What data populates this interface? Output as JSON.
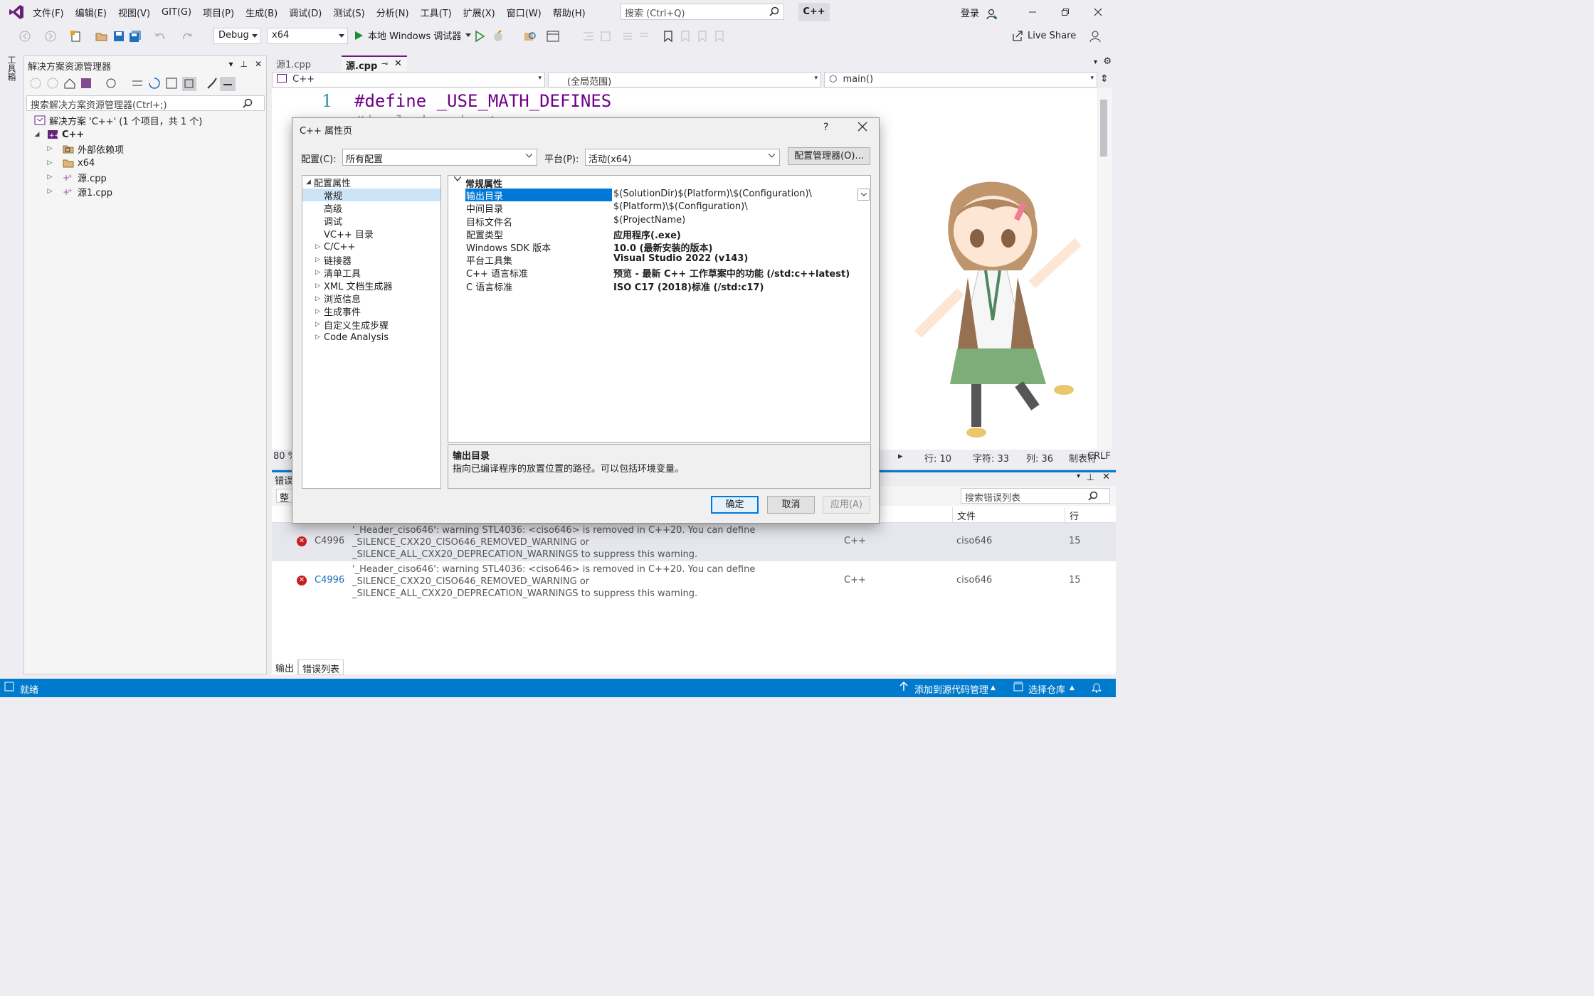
{
  "menubar": {
    "items": [
      "文件(F)",
      "编辑(E)",
      "视图(V)",
      "GIT(G)",
      "项目(P)",
      "生成(B)",
      "调试(D)",
      "测试(S)",
      "分析(N)",
      "工具(T)",
      "扩展(X)",
      "窗口(W)",
      "帮助(H)"
    ],
    "search_placeholder": "搜索 (Ctrl+Q)",
    "solution_chip": "C++",
    "login": "登录"
  },
  "toolbar": {
    "config": "Debug",
    "platform": "x64",
    "run_label": "本地 Windows 调试器",
    "live_share": "Live Share"
  },
  "toolbox_strip": "工具箱",
  "solution_explorer": {
    "title": "解决方案资源管理器",
    "search_placeholder": "搜索解决方案资源管理器(Ctrl+;)",
    "tree": [
      {
        "label": "解决方案 'C++' (1 个项目，共 1 个)",
        "level": 0,
        "icon": "solution-icon"
      },
      {
        "label": "C++",
        "level": 1,
        "icon": "project-icon"
      },
      {
        "label": "外部依赖项",
        "level": 2,
        "icon": "folder-icon"
      },
      {
        "label": "x64",
        "level": 2,
        "icon": "folder-icon"
      },
      {
        "label": "源.cpp",
        "level": 2,
        "icon": "cpp-file-icon"
      },
      {
        "label": "源1.cpp",
        "level": 2,
        "icon": "cpp-file-icon"
      }
    ]
  },
  "editor": {
    "tabs": [
      {
        "label": "源1.cpp",
        "active": false
      },
      {
        "label": "源.cpp",
        "active": true
      }
    ],
    "nav": {
      "project": "C++",
      "scope": "(全局范围)",
      "member": "main()"
    },
    "line1_number": "1",
    "line1_code": "#define _USE_MATH_DEFINES",
    "line2_code": "#include <iostream>",
    "zoom": "80 %",
    "status": {
      "line": "行: 10",
      "char": "字符: 33",
      "col": "列: 36",
      "tab": "制表符",
      "eol": "CRLF"
    }
  },
  "error_list": {
    "title": "错误",
    "scope": "整",
    "search_placeholder": "搜索错误列表",
    "columns": {
      "file": "文件",
      "line": "行"
    },
    "rows": [
      {
        "code": "C4996",
        "description": "'_Header_ciso646': warning STL4036: <ciso646> is removed in C++20. You can define _SILENCE_CXX20_CISO646_REMOVED_WARNING or _SILENCE_ALL_CXX20_DEPRECATION_WARNINGS to suppress this warning.",
        "project": "C++",
        "file": "ciso646",
        "line": "15"
      },
      {
        "code": "C4996",
        "description": "'_Header_ciso646': warning STL4036: <ciso646> is removed in C++20. You can define _SILENCE_CXX20_CISO646_REMOVED_WARNING or _SILENCE_ALL_CXX20_DEPRECATION_WARNINGS to suppress this warning.",
        "project": "C++",
        "file": "ciso646",
        "line": "15"
      }
    ],
    "bottom_tabs": [
      "输出",
      "错误列表"
    ]
  },
  "statusbar": {
    "ready": "就绪",
    "source_control": "添加到源代码管理",
    "repo": "选择仓库"
  },
  "dialog": {
    "title": "C++ 属性页",
    "help": "?",
    "config_label": "配置(C):",
    "config_value": "所有配置",
    "platform_label": "平台(P):",
    "platform_value": "活动(x64)",
    "config_manager": "配置管理器(O)...",
    "tree": [
      {
        "label": "配置属性",
        "level": 0,
        "expander": "open"
      },
      {
        "label": "常规",
        "level": 1,
        "expander": "none",
        "selected": true
      },
      {
        "label": "高级",
        "level": 1,
        "expander": "none"
      },
      {
        "label": "调试",
        "level": 1,
        "expander": "none"
      },
      {
        "label": "VC++ 目录",
        "level": 1,
        "expander": "none"
      },
      {
        "label": "C/C++",
        "level": 1,
        "expander": "closed"
      },
      {
        "label": "链接器",
        "level": 1,
        "expander": "closed"
      },
      {
        "label": "清单工具",
        "level": 1,
        "expander": "closed"
      },
      {
        "label": "XML 文档生成器",
        "level": 1,
        "expander": "closed"
      },
      {
        "label": "浏览信息",
        "level": 1,
        "expander": "closed"
      },
      {
        "label": "生成事件",
        "level": 1,
        "expander": "closed"
      },
      {
        "label": "自定义生成步骤",
        "level": 1,
        "expander": "closed"
      },
      {
        "label": "Code Analysis",
        "level": 1,
        "expander": "closed"
      }
    ],
    "category": "常规属性",
    "properties": [
      {
        "name": "输出目录",
        "value": "$(SolutionDir)$(Platform)\\$(Configuration)\\",
        "bold": false,
        "selected": true
      },
      {
        "name": "中间目录",
        "value": "$(Platform)\\$(Configuration)\\",
        "bold": false
      },
      {
        "name": "目标文件名",
        "value": "$(ProjectName)",
        "bold": false
      },
      {
        "name": "配置类型",
        "value": "应用程序(.exe)",
        "bold": true
      },
      {
        "name": "Windows SDK 版本",
        "value": "10.0 (最新安装的版本)",
        "bold": true
      },
      {
        "name": "平台工具集",
        "value": "Visual Studio 2022 (v143)",
        "bold": true
      },
      {
        "name": "C++ 语言标准",
        "value": "预览 - 最新 C++ 工作草案中的功能 (/std:c++latest)",
        "bold": true
      },
      {
        "name": "C 语言标准",
        "value": "ISO C17 (2018)标准 (/std:c17)",
        "bold": true
      }
    ],
    "desc_title": "输出目录",
    "desc_text": "指向已编译程序的放置位置的路径。可以包括环境变量。",
    "ok": "确定",
    "cancel": "取消",
    "apply": "应用(A)"
  },
  "colors": {
    "accent": "#007acc",
    "selection": "#0078d7",
    "error_icon": "#c51e1e",
    "preprocessor": "#6f008a",
    "line_number": "#2b91af"
  }
}
